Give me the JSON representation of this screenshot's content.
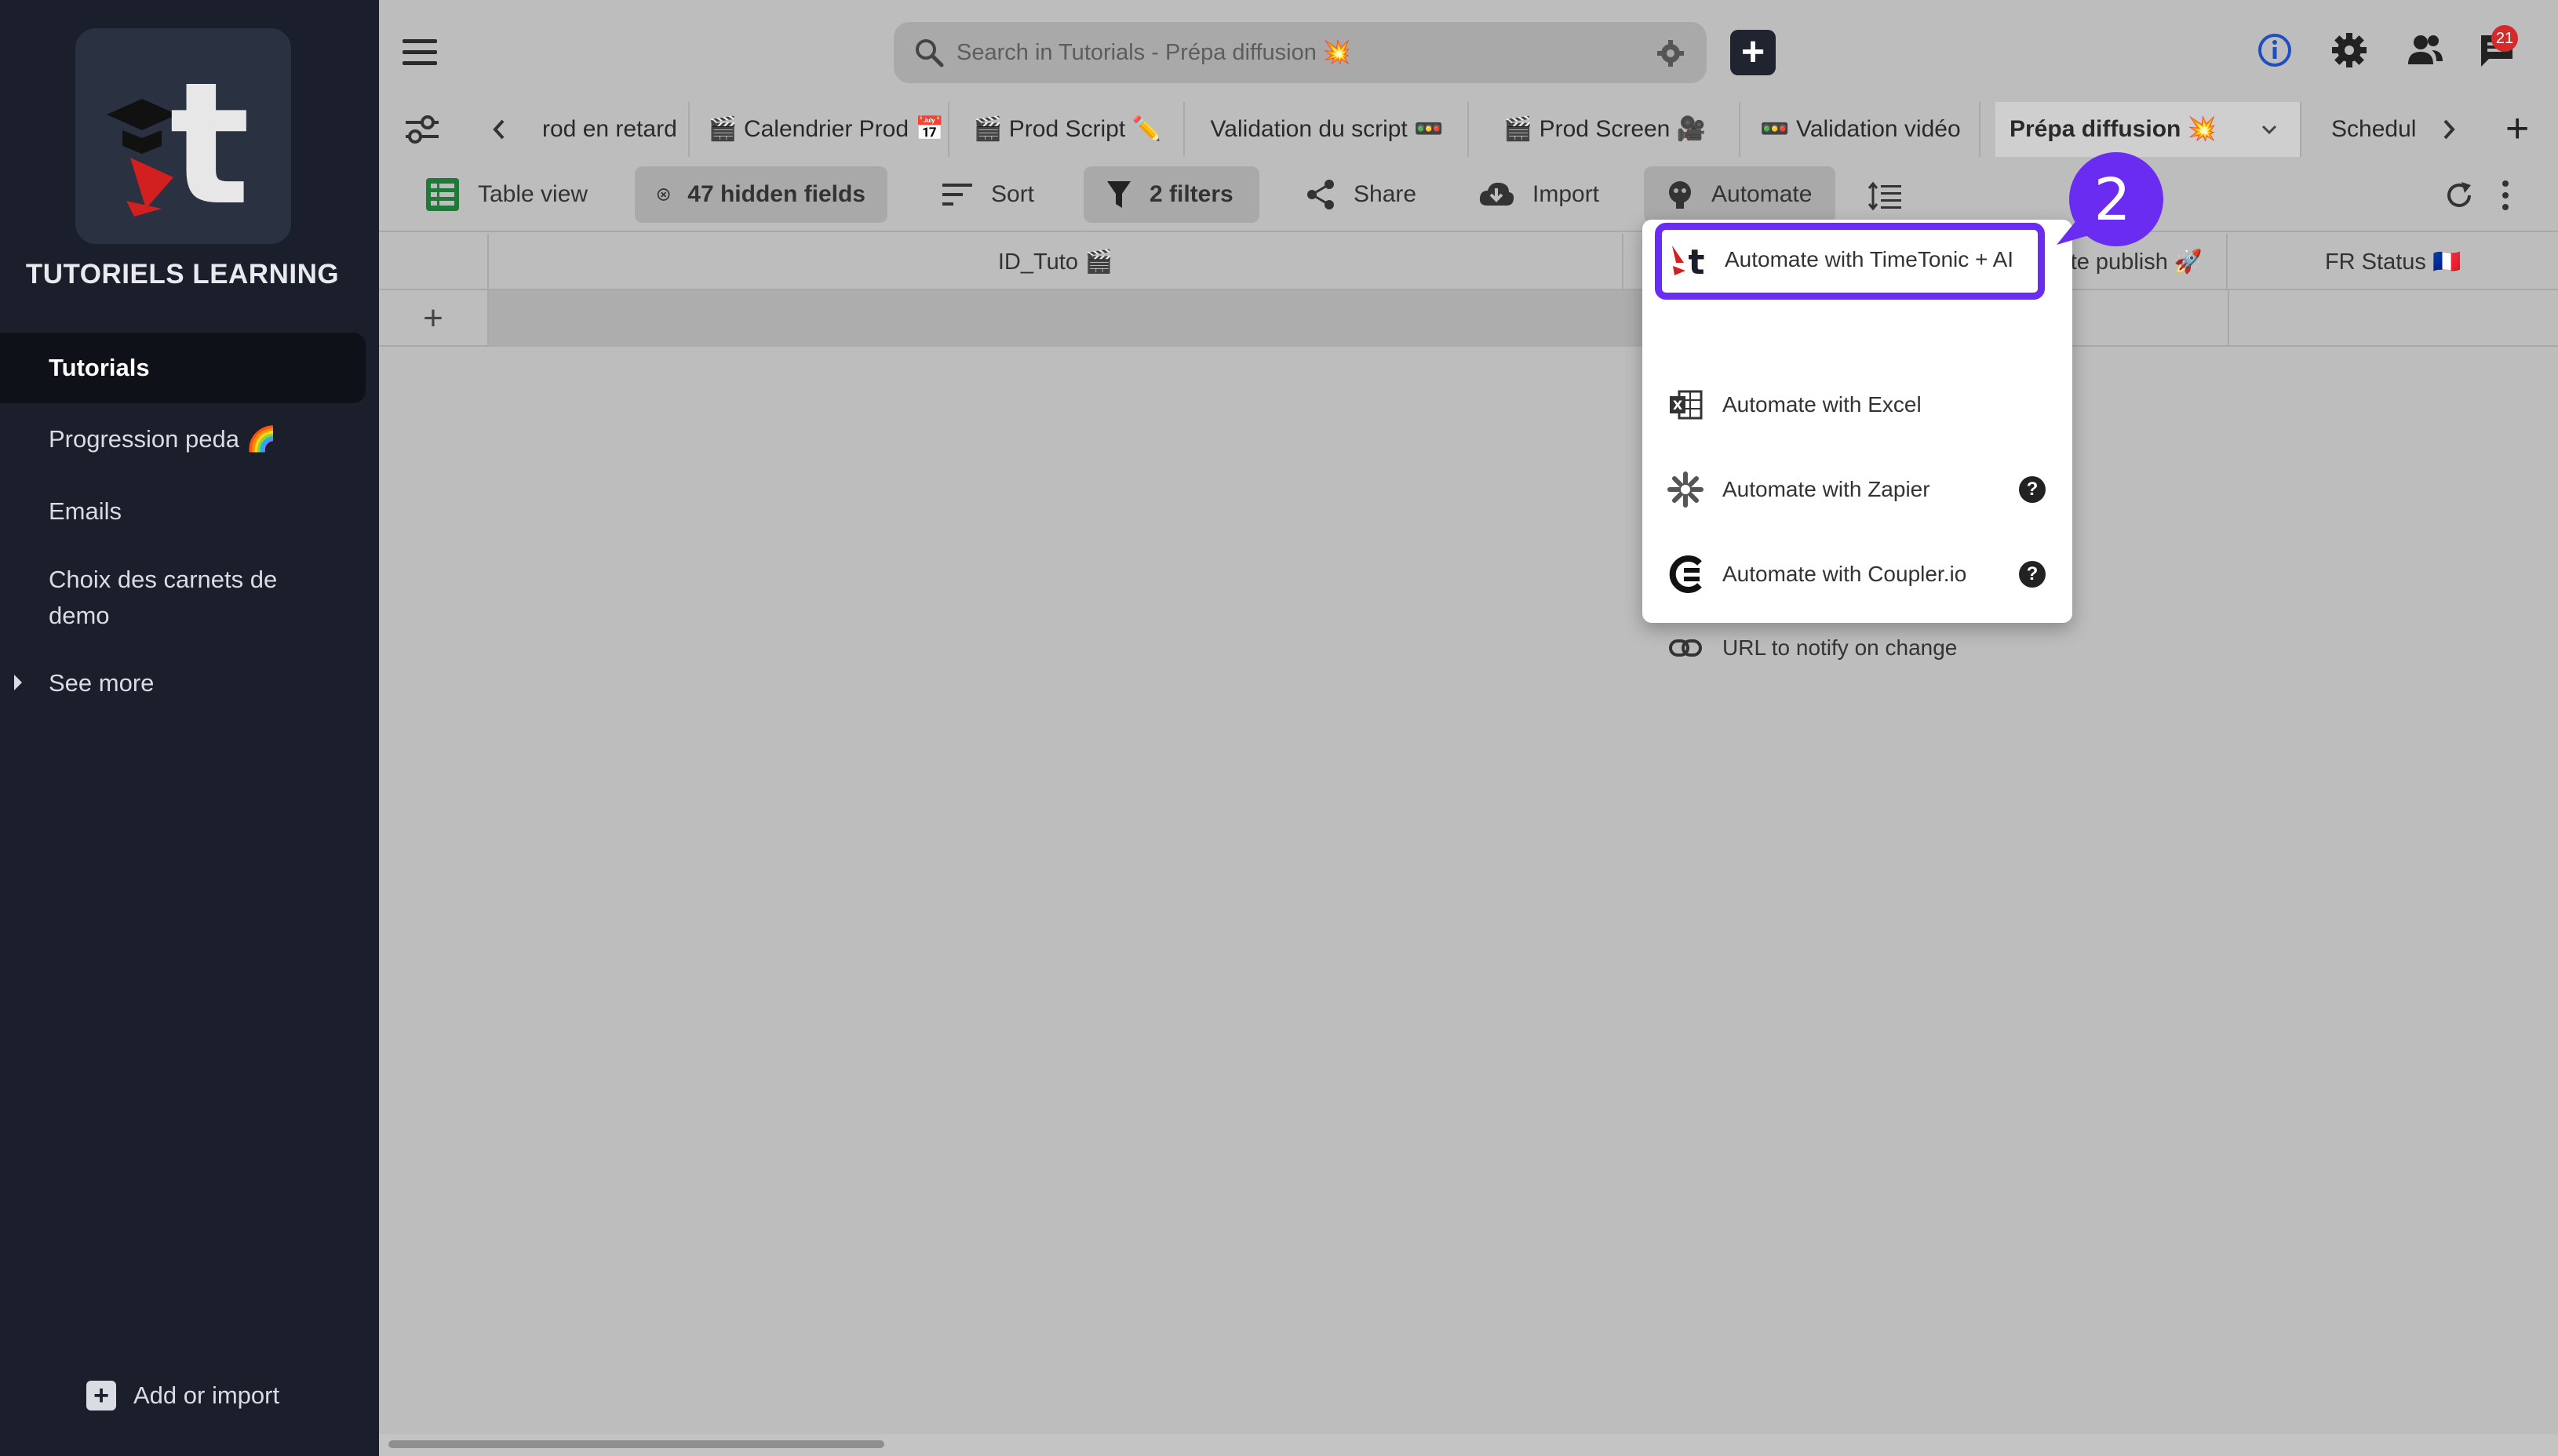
{
  "workspace": {
    "title": "TUTORIELS LEARNING"
  },
  "sidebar": {
    "items": [
      {
        "label": "Tutorials",
        "active": true
      },
      {
        "label": "Progression peda 🌈"
      },
      {
        "label": "Emails"
      },
      {
        "label": "Choix des carnets de demo"
      }
    ],
    "see_more": "See more",
    "add_import": "Add or import"
  },
  "search": {
    "placeholder": "Search in Tutorials - Prépa diffusion 💥"
  },
  "header": {
    "notifications_count": "21"
  },
  "tabs": [
    {
      "label": "rod en retard"
    },
    {
      "label": "🎬 Calendrier Prod 📅"
    },
    {
      "label": "🎬 Prod Script ✏️"
    },
    {
      "label": "Validation du script 🚥"
    },
    {
      "label": "🎬 Prod Screen 🎥"
    },
    {
      "label": "🚥 Validation vidéo"
    },
    {
      "label": "Prépa diffusion 💥",
      "active": true
    },
    {
      "label": "Schedul"
    }
  ],
  "toolbar": {
    "table_view": "Table view",
    "hidden_fields": "47 hidden fields",
    "sort": "Sort",
    "filters": "2 filters",
    "share": "Share",
    "import": "Import",
    "automate": "Automate"
  },
  "grid": {
    "columns": [
      "ID_Tuto 🎬",
      "te publish 🚀",
      "FR Status 🇫🇷"
    ],
    "add_row": "+"
  },
  "automate_menu": {
    "items": [
      {
        "label": "Automate with TimeTonic + AI",
        "icon": "timetonic-icon",
        "highlighted": true
      },
      {
        "label": "Automate with Excel",
        "icon": "excel-icon"
      },
      {
        "label": "Automate with Zapier",
        "icon": "zapier-icon",
        "help": "?"
      },
      {
        "label": "Automate with Coupler.io",
        "icon": "coupler-icon",
        "help": "?"
      },
      {
        "label": "URL to notify on change",
        "icon": "link-icon"
      }
    ]
  },
  "step": {
    "number": "2",
    "color": "#6a2cf0"
  }
}
